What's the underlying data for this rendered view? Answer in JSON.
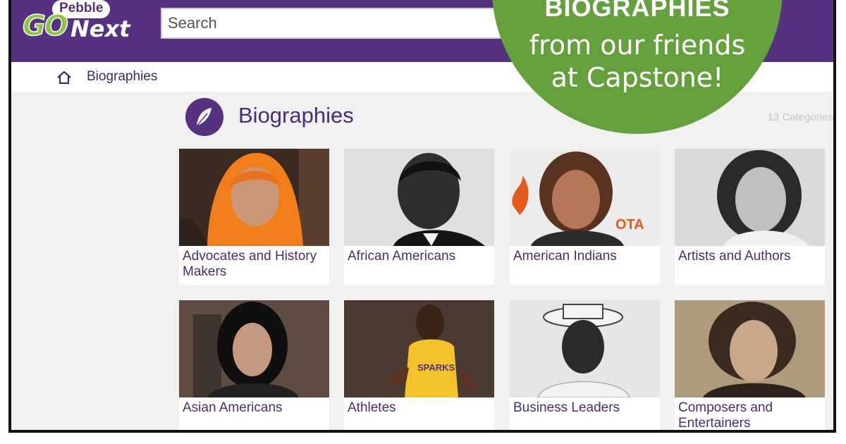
{
  "logo": {
    "brand_top": "Pebble",
    "brand_go": "GO",
    "brand_next": "Next"
  },
  "search": {
    "placeholder": "Search"
  },
  "breadcrumb": {
    "label": "Biographies"
  },
  "section": {
    "title": "Biographies",
    "count": "13 Categories"
  },
  "badge": {
    "title": "BIOGRAPHIES",
    "line1": "from our friends",
    "line2": "at Capstone!"
  },
  "categories": [
    {
      "label": "Advocates and History Makers"
    },
    {
      "label": "African Americans"
    },
    {
      "label": "American Indians"
    },
    {
      "label": "Artists and Authors"
    },
    {
      "label": "Asian Americans"
    },
    {
      "label": "Athletes"
    },
    {
      "label": "Business Leaders"
    },
    {
      "label": "Composers and Entertainers"
    }
  ],
  "colors": {
    "brand_purple": "#55317f",
    "badge_green": "#64a03b",
    "logo_green": "#8cc63f"
  }
}
